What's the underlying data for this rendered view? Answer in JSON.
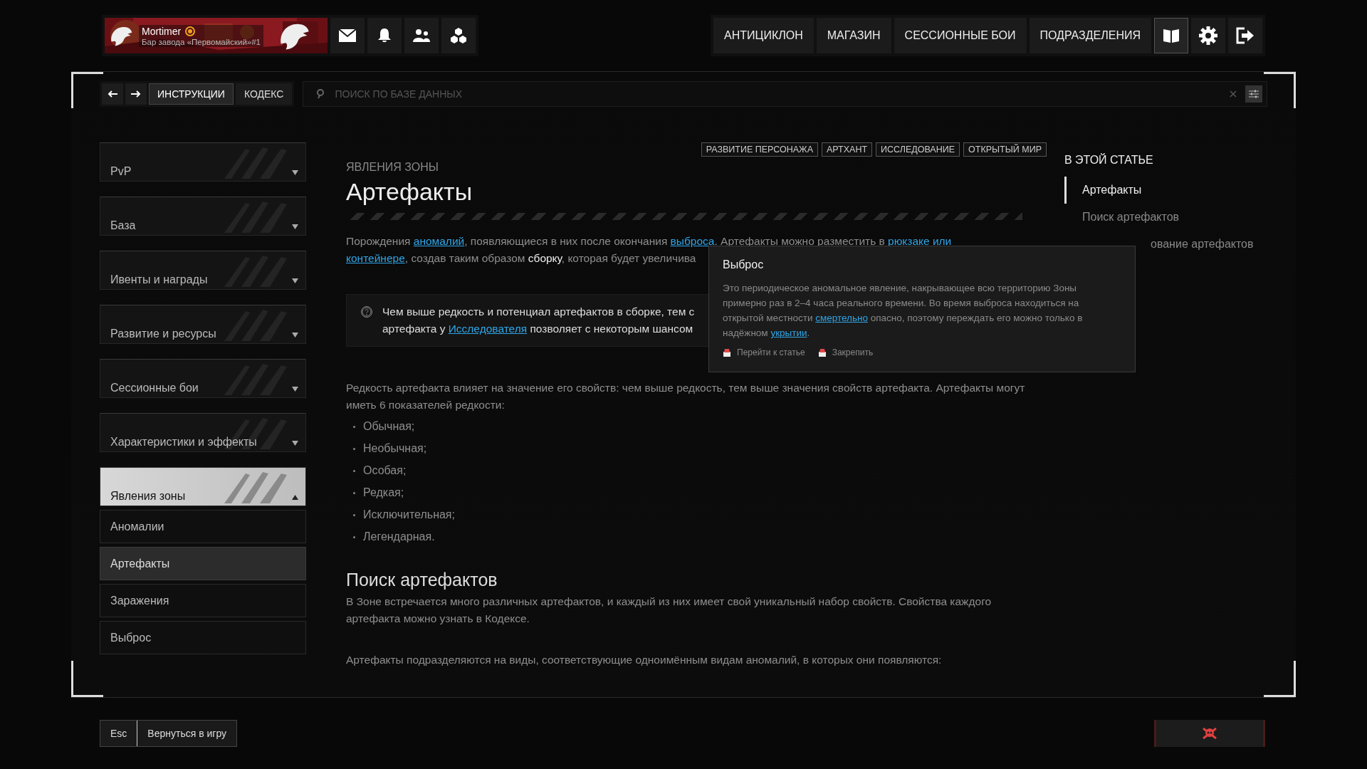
{
  "profile": {
    "name": "Mortimer",
    "subtitle": "Бар завода «Первомайский»#1"
  },
  "top_icons": [
    {
      "kind": "mail"
    },
    {
      "kind": "bell"
    },
    {
      "kind": "people"
    },
    {
      "kind": "hex"
    }
  ],
  "nav": [
    {
      "label": "АНТИЦИКЛОН"
    },
    {
      "label": "МАГАЗИН"
    },
    {
      "label": "СЕССИОННЫЕ БОИ"
    },
    {
      "label": "ПОДРАЗДЕЛЕНИЯ"
    }
  ],
  "nav_icons": [
    {
      "kind": "book",
      "selected": true
    },
    {
      "kind": "gear",
      "selected": false
    },
    {
      "kind": "exit",
      "selected": false
    }
  ],
  "tabs": [
    {
      "label": "ИНСТРУКЦИИ",
      "selected": true
    },
    {
      "label": "КОДЕКС",
      "selected": false
    }
  ],
  "search": {
    "placeholder": "ПОИСК ПО БАЗЕ ДАННЫХ"
  },
  "sidebar": [
    {
      "label": "PvP",
      "expanded": false
    },
    {
      "label": "База",
      "expanded": false
    },
    {
      "label": "Ивенты и награды",
      "expanded": false
    },
    {
      "label": "Развитие и ресурсы",
      "expanded": false
    },
    {
      "label": "Сессионные бои",
      "expanded": false
    },
    {
      "label": "Характеристики и эффекты",
      "expanded": false
    },
    {
      "label": "Явления зоны",
      "expanded": true,
      "children": [
        {
          "label": "Аномалии",
          "selected": false
        },
        {
          "label": "Артефакты",
          "selected": true
        },
        {
          "label": "Заражения",
          "selected": false
        },
        {
          "label": "Выброс",
          "selected": false
        }
      ]
    }
  ],
  "article": {
    "tags": [
      "РАЗВИТИЕ ПЕРСОНАЖА",
      "АРТХАНТ",
      "ИССЛЕДОВАНИЕ",
      "ОТКРЫТЫЙ МИР"
    ],
    "category": "ЯВЛЕНИЯ ЗОНЫ",
    "title": "Артефакты",
    "intro": [
      [
        {
          "kind": "text",
          "text": "Порождения "
        },
        {
          "kind": "link",
          "text": "аномалий"
        },
        {
          "kind": "text",
          "text": ", появляющиеся в них после окончания "
        },
        {
          "kind": "link",
          "text": "выброса"
        },
        {
          "kind": "text",
          "text": ". Артефакты можно разместить в "
        },
        {
          "kind": "link",
          "text": "рюкзаке или"
        }
      ],
      [
        {
          "kind": "link",
          "text": "контейнере"
        },
        {
          "kind": "text",
          "text": ", создав таким образом "
        },
        {
          "kind": "term",
          "text": "сборку"
        },
        {
          "kind": "text",
          "text": ", которая будет увеличива"
        }
      ]
    ],
    "callout": [
      [
        {
          "kind": "text",
          "text": "Чем выше редкость и потенциал артефактов в сборке, тем с"
        }
      ],
      [
        {
          "kind": "text",
          "text": "артефакта у "
        },
        {
          "kind": "link",
          "text": "Исследователя"
        },
        {
          "kind": "text",
          "text": " позволяет с некоторым шансом"
        }
      ]
    ],
    "rarity_text": "Редкость артефакта влияет на значение его свойств: чем выше редкость, тем выше значения свойств артефакта. Артефакты могут иметь 6 показателей редкости:",
    "rarities": [
      "Обычная;",
      "Необычная;",
      "Особая;",
      "Редкая;",
      "Исключительная;",
      "Легендарная."
    ],
    "section_title": "Поиск артефактов",
    "section_text": "В Зоне встречается много различных артефактов, и каждый из них имеет свой уникальный набор свойств. Свойства каждого артефакта можно узнать в Кодексе.",
    "section_text_2": "Артефакты подразделяются на виды, соответствующие одноимённым видам аномалий, в которых они появляются:"
  },
  "toc": {
    "title": "В ЭТОЙ СТАТЬЕ",
    "items": [
      {
        "label": "Артефакты",
        "selected": true,
        "cut": false
      },
      {
        "label": "Поиск артефактов",
        "selected": false,
        "cut": false
      },
      {
        "label": "ование артефактов",
        "selected": false,
        "cut": true
      }
    ]
  },
  "tooltip": {
    "title": "Выброс",
    "text": [
      {
        "kind": "text",
        "text": "Это периодическое аномальное явление, накрывающее всю территорию Зоны примерно раз в 2–4 часа реального времени. Во время выброса находиться на открытой местности "
      },
      {
        "kind": "link",
        "text": "смертельно"
      },
      {
        "kind": "text",
        "text": " опасно, поэтому переждать его можно только в надёжном "
      },
      {
        "kind": "link",
        "text": "укрытии"
      },
      {
        "kind": "text",
        "text": "."
      }
    ],
    "actions": [
      "Перейти к статье",
      "Закрепить"
    ]
  },
  "footer": {
    "key": "Esc",
    "label": "Вернуться в игру"
  }
}
